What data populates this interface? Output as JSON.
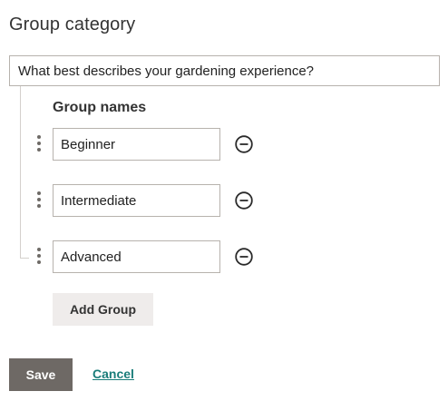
{
  "form": {
    "heading": "Group category",
    "category_question": "What best describes your gardening experience?"
  },
  "groups": {
    "label": "Group names",
    "items": [
      {
        "value": "Beginner",
        "remove_icon": "minus-circle-icon",
        "drag_icon": "drag-handle-icon"
      },
      {
        "value": "Intermediate",
        "remove_icon": "minus-circle-icon",
        "drag_icon": "drag-handle-icon"
      },
      {
        "value": "Advanced",
        "remove_icon": "minus-circle-icon",
        "drag_icon": "drag-handle-icon"
      }
    ],
    "add_label": "Add Group"
  },
  "actions": {
    "save_label": "Save",
    "cancel_label": "Cancel"
  },
  "colors": {
    "primary_button": "#6e6965",
    "link": "#1a7d7a",
    "secondary_button": "#efeceb",
    "border": "#b7b2ad"
  }
}
